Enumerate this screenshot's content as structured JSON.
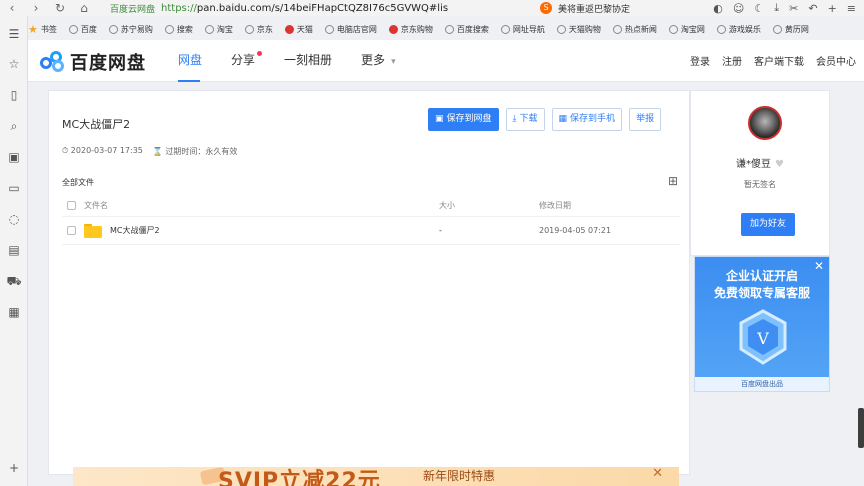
{
  "browser": {
    "site_label": "百度云网盘",
    "url_scheme": "https://",
    "url_host": "pan.baidu.com",
    "url_path": "/s/14beiFHapCtQZ8I76c5GVWQ#lis",
    "search_tag": "美将重返巴黎协定",
    "bookmarks": [
      {
        "label": "书签",
        "icon": "star-icon"
      },
      {
        "label": "百度",
        "icon": "globe-icon"
      },
      {
        "label": "苏宁易购",
        "icon": "globe-icon"
      },
      {
        "label": "搜索",
        "icon": "globe-icon"
      },
      {
        "label": "淘宝",
        "icon": "globe-icon"
      },
      {
        "label": "京东",
        "icon": "globe-icon"
      },
      {
        "label": "天猫",
        "icon": "tmall-icon"
      },
      {
        "label": "电脑店官网",
        "icon": "globe-icon"
      },
      {
        "label": "京东购物",
        "icon": "jd-icon"
      },
      {
        "label": "百度搜索",
        "icon": "globe-icon"
      },
      {
        "label": "网址导航",
        "icon": "globe-icon"
      },
      {
        "label": "天猫购物",
        "icon": "globe-icon"
      },
      {
        "label": "热点新闻",
        "icon": "globe-icon"
      },
      {
        "label": "淘宝网",
        "icon": "globe-icon"
      },
      {
        "label": "游戏娱乐",
        "icon": "globe-icon"
      },
      {
        "label": "黄历网",
        "icon": "globe-icon"
      }
    ]
  },
  "header": {
    "logo_text": "百度网盘",
    "tabs": [
      {
        "label": "网盘",
        "active": true
      },
      {
        "label": "分享",
        "dot": true
      },
      {
        "label": "一刻相册"
      },
      {
        "label": "更多"
      }
    ],
    "links": [
      "登录",
      "注册",
      "客户端下载",
      "会员中心"
    ]
  },
  "share": {
    "title": "MC大战僵尸2",
    "created": "2020-03-07 17:35",
    "expire": "过期时间：永久有效",
    "actions": {
      "save": "保存到网盘",
      "download": "下载",
      "save_phone": "保存到手机",
      "report": "举报"
    },
    "breadcrumb": "全部文件",
    "columns": {
      "name": "文件名",
      "size": "大小",
      "date": "修改日期"
    },
    "files": [
      {
        "name": "MC大战僵尸2",
        "size": "-",
        "date": "2019-04-05 07:21"
      }
    ]
  },
  "profile": {
    "username": "谦*傻豆",
    "signature": "暂无签名",
    "add_friend": "加为好友"
  },
  "promo": {
    "line1": "企业认证开启",
    "line2": "免费领取专属客服",
    "footer": "百度网盘出品"
  },
  "banner": {
    "text": "SVIP立减22元",
    "sub": "新年限时特惠"
  }
}
